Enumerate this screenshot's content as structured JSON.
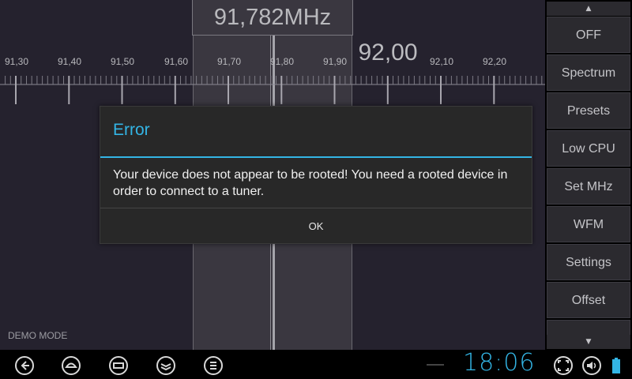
{
  "tuner": {
    "current_freq": "91,782MHz",
    "center_label": "92,00",
    "tick_labels": [
      "91,30",
      "91,40",
      "91,50",
      "91,60",
      "91,70",
      "91,80",
      "91,90",
      "92,10",
      "92,20"
    ]
  },
  "sidebar": {
    "up_arrow": "▲",
    "down_arrow": "▼",
    "items": [
      "OFF",
      "Spectrum",
      "Presets",
      "Low CPU",
      "Set MHz",
      "WFM",
      "Settings",
      "Offset"
    ]
  },
  "status": {
    "demo_mode": "DEMO MODE"
  },
  "dialog": {
    "title": "Error",
    "message": "Your device does not appear to be rooted! You need a rooted device in order to connect to a tuner.",
    "ok_label": "OK"
  },
  "navbar": {
    "clock": "18:06"
  },
  "colors": {
    "accent": "#33b5e5",
    "background": "#25222e"
  }
}
